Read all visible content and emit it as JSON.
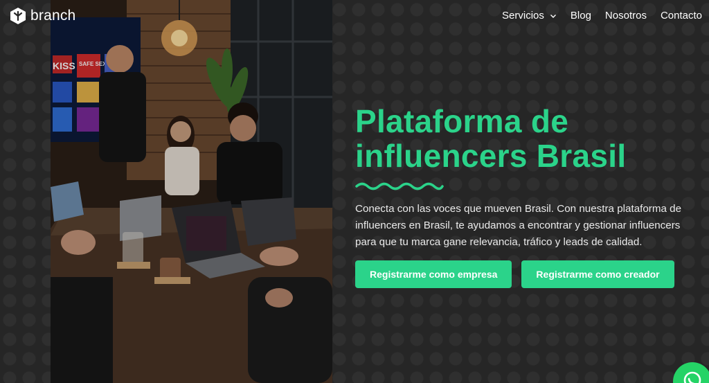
{
  "header": {
    "brand": "branch",
    "nav": [
      {
        "label": "Servicios",
        "has_dropdown": true
      },
      {
        "label": "Blog"
      },
      {
        "label": "Nosotros"
      },
      {
        "label": "Contacto"
      }
    ]
  },
  "hero": {
    "title_line1": "Plataforma de",
    "title_line2": "influencers Brasil",
    "description": "Conecta con las voces que mueven Brasil. Con nuestra plataforma de influencers en Brasil, te ayudamos a encontrar y gestionar influencers para que tu marca gane relevancia, tráfico y leads de calidad.",
    "btn_company": "Registrarme como empresa",
    "btn_creator": "Registrarme como creador"
  },
  "photo": {
    "screen_labels": [
      "KISS",
      "SAFE SEX"
    ]
  },
  "colors": {
    "accent": "#2bd38a",
    "background": "#262626",
    "whatsapp": "#25d366"
  }
}
